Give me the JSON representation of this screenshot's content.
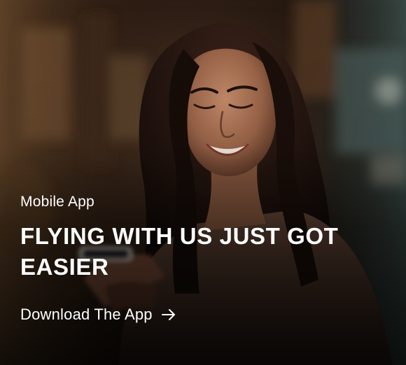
{
  "promo": {
    "eyebrow": "Mobile App",
    "headline": "FLYING WITH US JUST GOT EASIER",
    "cta_label": "Download The App",
    "cta_icon": "arrow-right-icon",
    "image_alt": "Woman smiling while looking at her phone"
  },
  "colors": {
    "text": "#ffffff",
    "background": "#0e0a08"
  }
}
